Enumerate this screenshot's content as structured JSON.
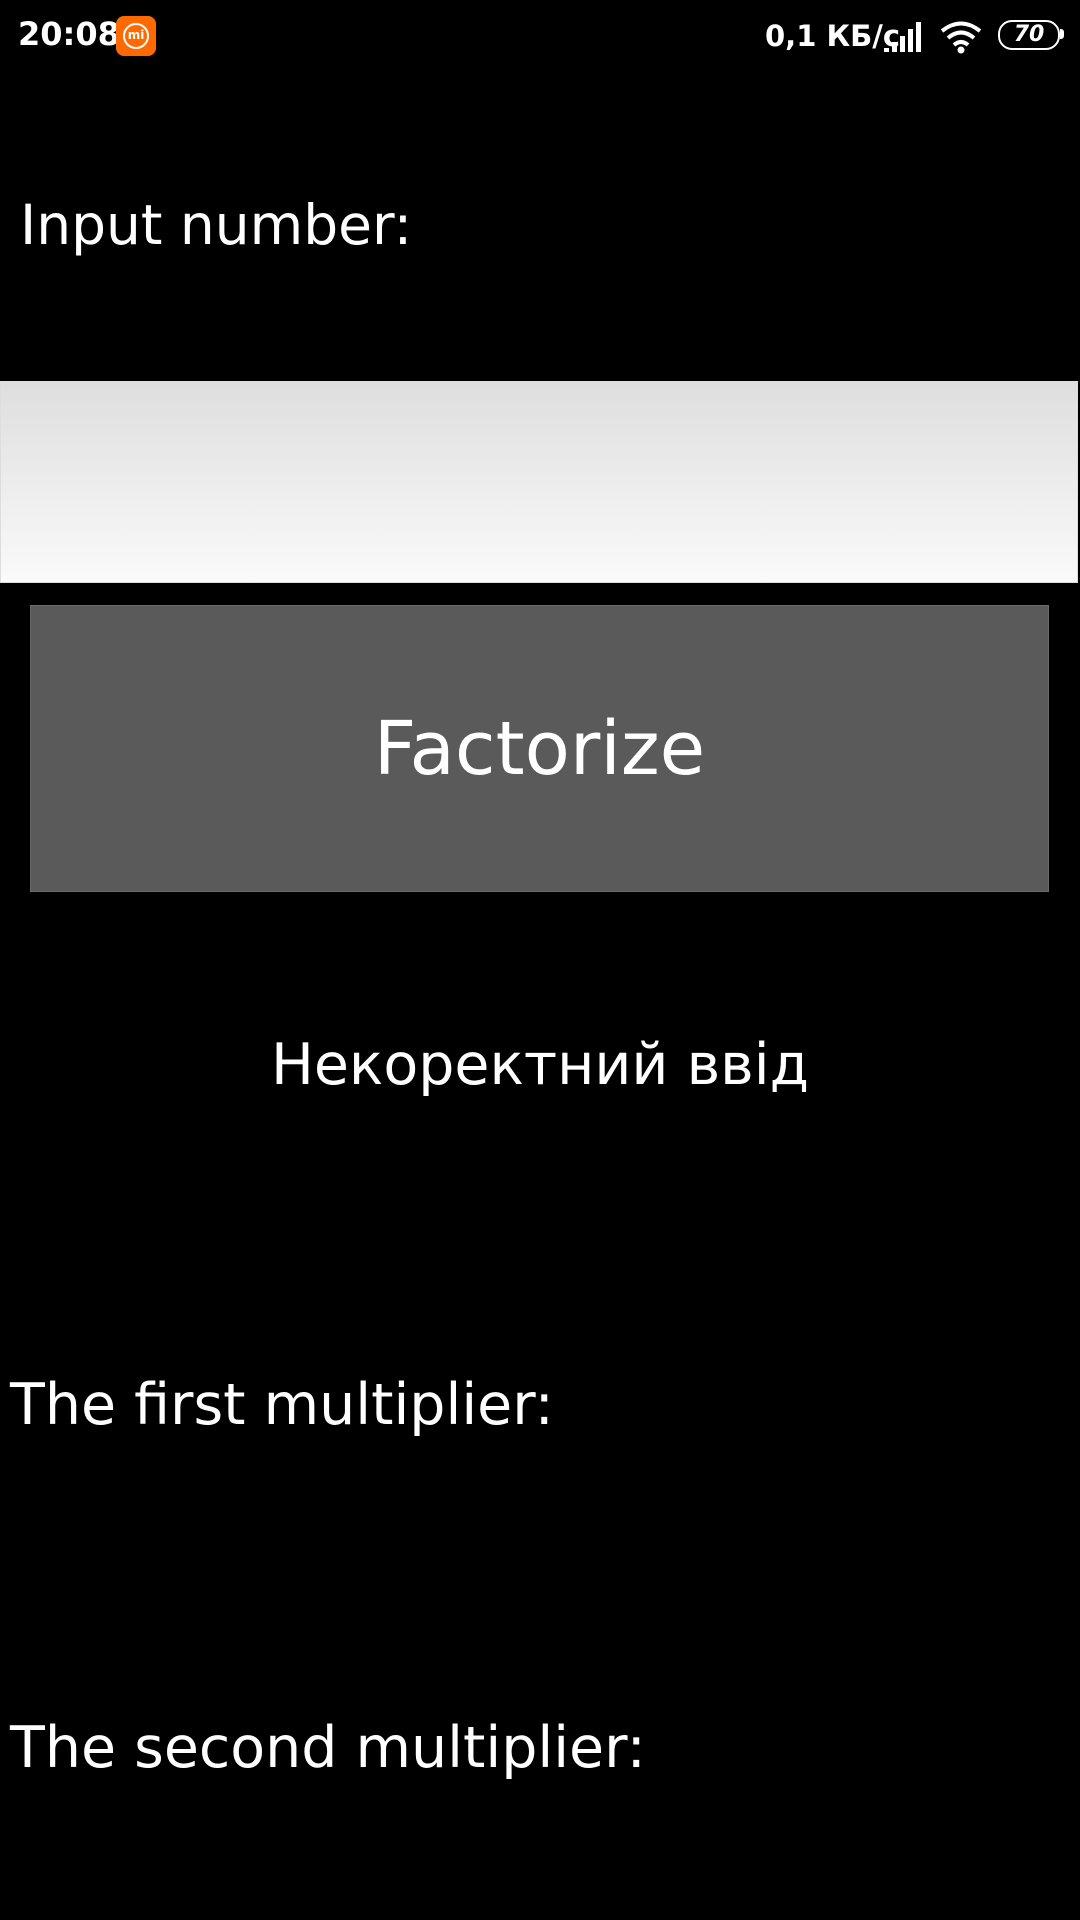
{
  "status_bar": {
    "time": "20:08",
    "app_icon": "mi-icon",
    "app_icon_text": "mi",
    "network_speed": "0,1 КБ/с",
    "signal_icon": "signal-icon",
    "wifi_icon": "wifi-icon",
    "battery_level": "70"
  },
  "form": {
    "input_label": "Input number:",
    "input_value": "",
    "input_placeholder": "",
    "button_label": "Factorize"
  },
  "result": {
    "message": "Некоректний ввід",
    "first_multiplier_label": "The first multiplier:",
    "second_multiplier_label": "The second multiplier:"
  },
  "colors": {
    "background": "#000000",
    "button": "#5a5a5a",
    "accent": "#ff6a00"
  }
}
